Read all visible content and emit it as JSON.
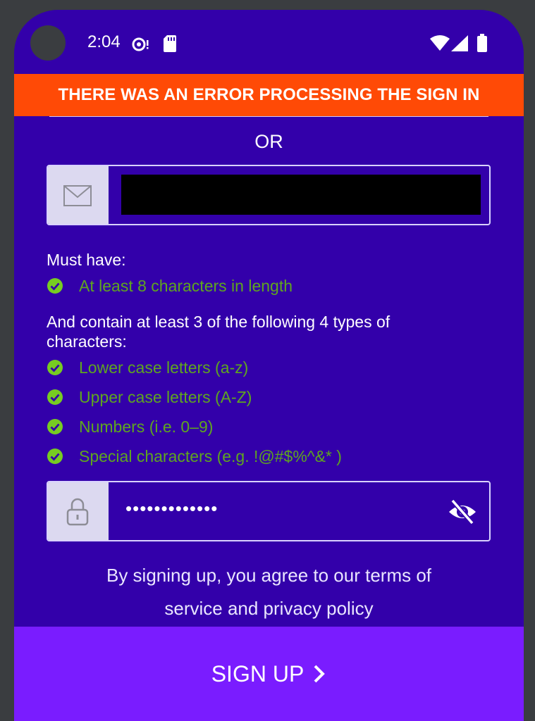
{
  "status_bar": {
    "time": "2:04",
    "icons": [
      "notification-icon",
      "sd-card-icon",
      "wifi-icon",
      "signal-icon",
      "battery-icon"
    ]
  },
  "error_banner": {
    "text": "THERE WAS AN ERROR PROCESSING THE SIGN IN",
    "color": "#ff4a06"
  },
  "or_label": "OR",
  "email_field": {
    "icon": "mail-icon",
    "value_redacted": true
  },
  "requirements": {
    "must_have_heading": "Must have:",
    "must_have_items": [
      {
        "label": "At least 8 characters in length",
        "met": true
      }
    ],
    "contain_heading": "And contain at least 3 of the following 4 types of characters:",
    "contain_items": [
      {
        "label": "Lower case letters (a-z)",
        "met": true
      },
      {
        "label": "Upper case letters (A-Z)",
        "met": true
      },
      {
        "label": "Numbers (i.e. 0–9)",
        "met": true
      },
      {
        "label": "Special characters (e.g. !@#$%^&* )",
        "met": true
      }
    ],
    "met_color": "#5fa61f"
  },
  "password_field": {
    "icon": "lock-icon",
    "value": "•••••••••••••",
    "toggle_icon": "eye-off-icon"
  },
  "terms": {
    "line1": "By signing up, you agree to our terms of",
    "line2": "service and privacy policy"
  },
  "signup_button": {
    "label": "SIGN UP",
    "color": "#7a1cff"
  },
  "colors": {
    "background": "#3300aa",
    "accent": "#7a1cff",
    "error": "#ff4a06"
  }
}
